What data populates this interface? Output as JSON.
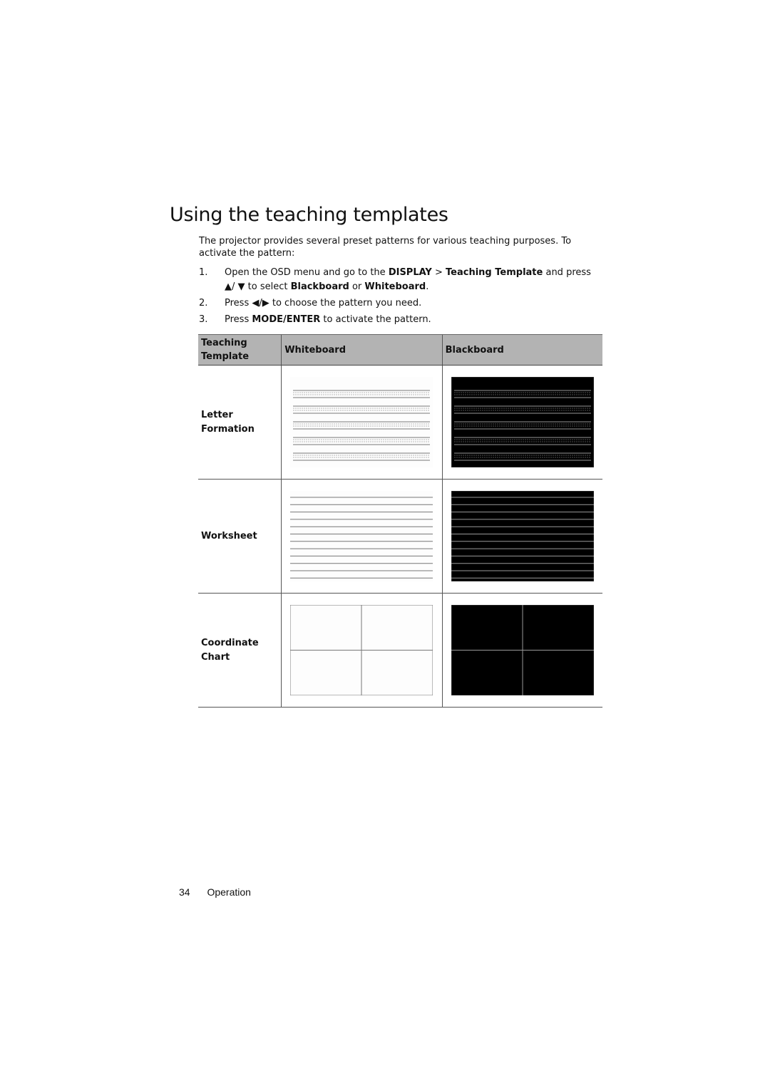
{
  "heading": "Using the teaching templates",
  "intro": "The projector provides several preset patterns for various teaching purposes. To activate the pattern:",
  "steps": [
    {
      "num": "1.",
      "parts": [
        {
          "text": "Open the OSD menu and go to the ",
          "bold": false
        },
        {
          "text": "DISPLAY",
          "bold": true
        },
        {
          "text": " > ",
          "bold": false
        },
        {
          "text": "Teaching Template",
          "bold": true
        },
        {
          "text": " and press ▲/ ▼ to select ",
          "bold": false
        },
        {
          "text": "Blackboard",
          "bold": true
        },
        {
          "text": " or ",
          "bold": false
        },
        {
          "text": "Whiteboard",
          "bold": true
        },
        {
          "text": ".",
          "bold": false
        }
      ]
    },
    {
      "num": "2.",
      "parts": [
        {
          "text": "Press ◀/▶ to choose the pattern you need.",
          "bold": false
        }
      ]
    },
    {
      "num": "3.",
      "parts": [
        {
          "text": "Press ",
          "bold": false
        },
        {
          "text": "MODE/ENTER",
          "bold": true
        },
        {
          "text": " to activate the pattern.",
          "bold": false
        }
      ]
    }
  ],
  "table": {
    "headers": [
      "Teaching Template",
      "Whiteboard",
      "Blackboard"
    ],
    "rows": [
      {
        "label": "Letter Formation",
        "pattern": "letter-formation"
      },
      {
        "label": "Worksheet",
        "pattern": "worksheet"
      },
      {
        "label": "Coordinate Chart",
        "pattern": "coordinate-chart"
      }
    ]
  },
  "colors": {
    "whiteboard_bg": "#fdfdfd",
    "whiteboard_line": "#777777",
    "blackboard_bg": "#000000",
    "blackboard_line": "#999999",
    "header_bg": "#b3b3b3"
  },
  "footer": {
    "page_number": "34",
    "section": "Operation"
  }
}
